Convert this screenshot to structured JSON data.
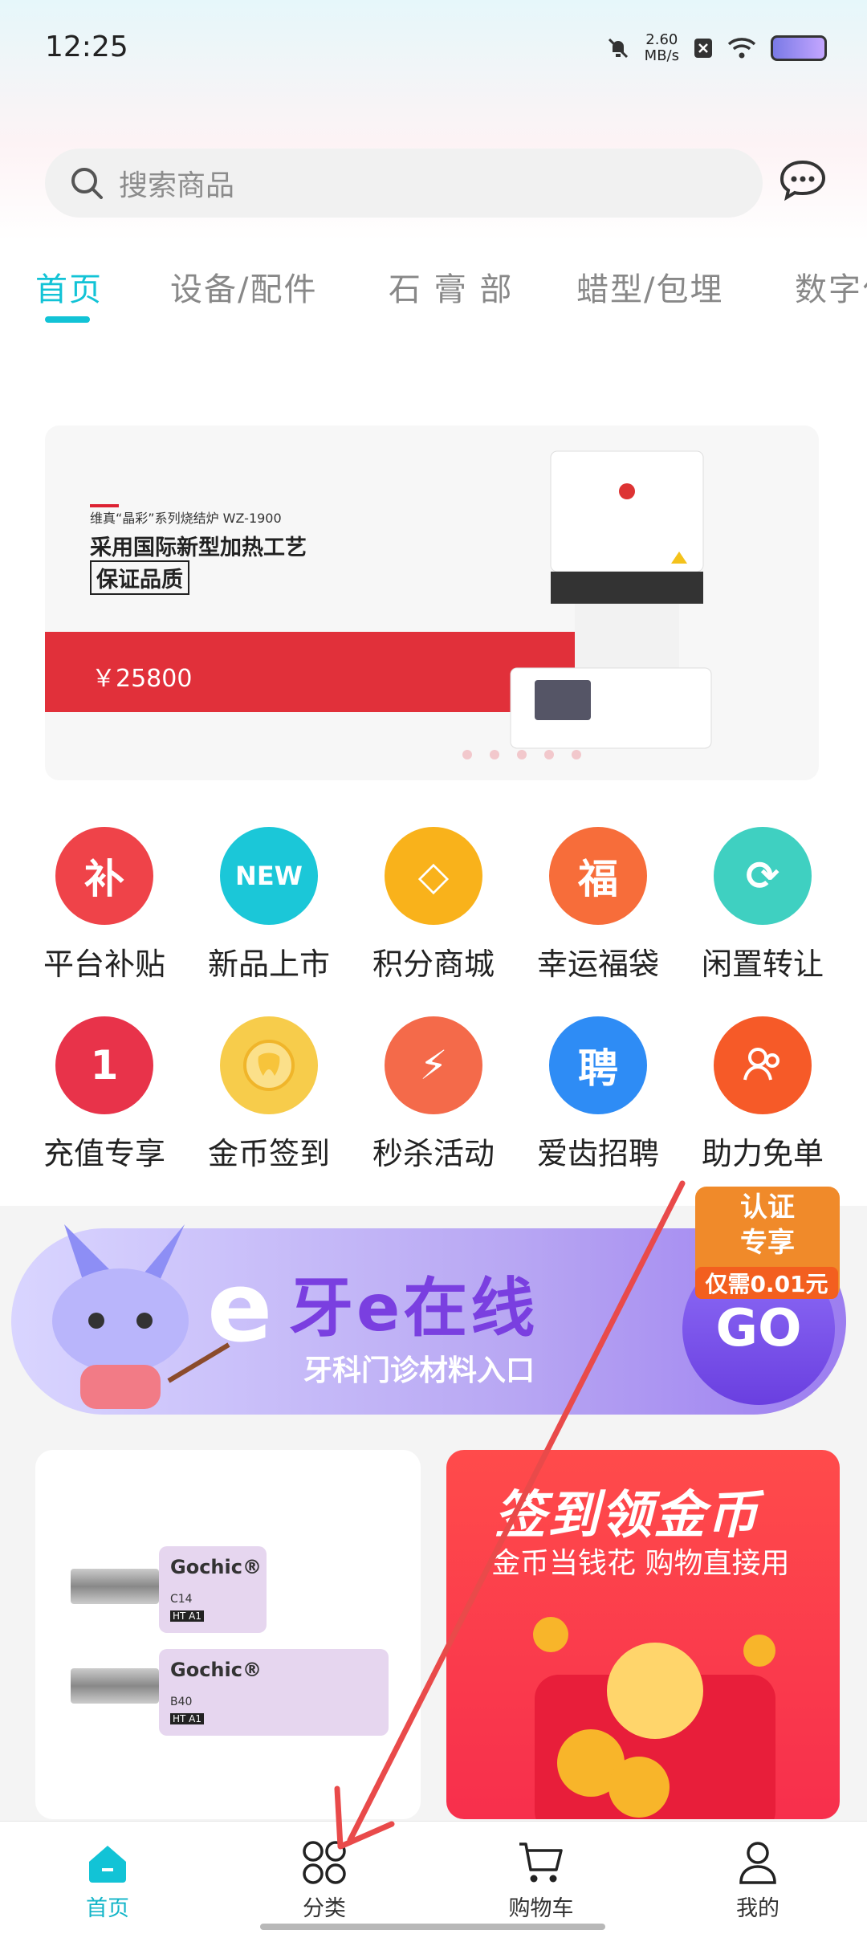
{
  "status_bar": {
    "time": "12:25",
    "speed_value": "2.60",
    "speed_unit": "MB/s",
    "icons": [
      "mute-icon",
      "close-box-icon",
      "wifi-icon",
      "battery-icon"
    ]
  },
  "search": {
    "placeholder": "搜索商品",
    "message_icon": "chat-bubble-icon"
  },
  "tabs": [
    {
      "label": "首页",
      "active": true
    },
    {
      "label": "设备/配件"
    },
    {
      "label": "石 膏 部"
    },
    {
      "label": "蜡型/包埋"
    },
    {
      "label": "数字化"
    }
  ],
  "banner": {
    "subtitle": "维真“晶彩”系列烧结炉 WZ-1900",
    "title": "采用国际新型加热工艺",
    "badge": "保证品质",
    "price": "￥25800",
    "accent": "#e1303a"
  },
  "grid_row1": [
    {
      "label": "平台补贴",
      "glyph": "补",
      "color": "#ef4349",
      "icon": "subsidy-icon"
    },
    {
      "label": "新品上市",
      "glyph": "NEW",
      "color": "#1bc7d8",
      "icon": "new-icon"
    },
    {
      "label": "积分商城",
      "glyph": "◇",
      "color": "#f9b21b",
      "icon": "diamond-icon"
    },
    {
      "label": "幸运福袋",
      "glyph": "福",
      "color": "#f76d3a",
      "icon": "lucky-bag-icon"
    },
    {
      "label": "闲置转让",
      "glyph": "⟳",
      "color": "#3fd0c1",
      "icon": "transfer-icon"
    }
  ],
  "grid_row2": [
    {
      "label": "充值专享",
      "glyph": "1",
      "color": "#e8334a",
      "icon": "recharge-icon"
    },
    {
      "label": "金币签到",
      "glyph": "",
      "color": "#f7cc4b",
      "icon": "gold-coin-icon"
    },
    {
      "label": "秒杀活动",
      "glyph": "⚡",
      "color": "#f46a4a",
      "icon": "flash-sale-icon"
    },
    {
      "label": "爱齿招聘",
      "glyph": "聘",
      "color": "#2e8cf5",
      "icon": "recruit-icon"
    },
    {
      "label": "助力免单",
      "glyph": "",
      "color": "#f65a28",
      "icon": "help-free-icon"
    }
  ],
  "promo": {
    "title": "牙e在线",
    "subtitle": "牙科门诊材料入口",
    "go": "GO",
    "tag": "认证专享",
    "tag_price": "仅需0.01元"
  },
  "card_left": {
    "products": [
      {
        "name": "Gochic®",
        "code": "C14",
        "grade": "HT A1"
      },
      {
        "name": "Gochic®",
        "code": "B40",
        "grade": "HT A1"
      }
    ]
  },
  "card_right": {
    "title": "签到领金币",
    "subtitle": "金币当钱花  购物直接用"
  },
  "bottom_nav": [
    {
      "label": "首页",
      "active": true
    },
    {
      "label": "分类"
    },
    {
      "label": "购物车"
    },
    {
      "label": "我的"
    }
  ],
  "colors": {
    "accent": "#12c3d6",
    "annotation": "#e94a4a"
  }
}
